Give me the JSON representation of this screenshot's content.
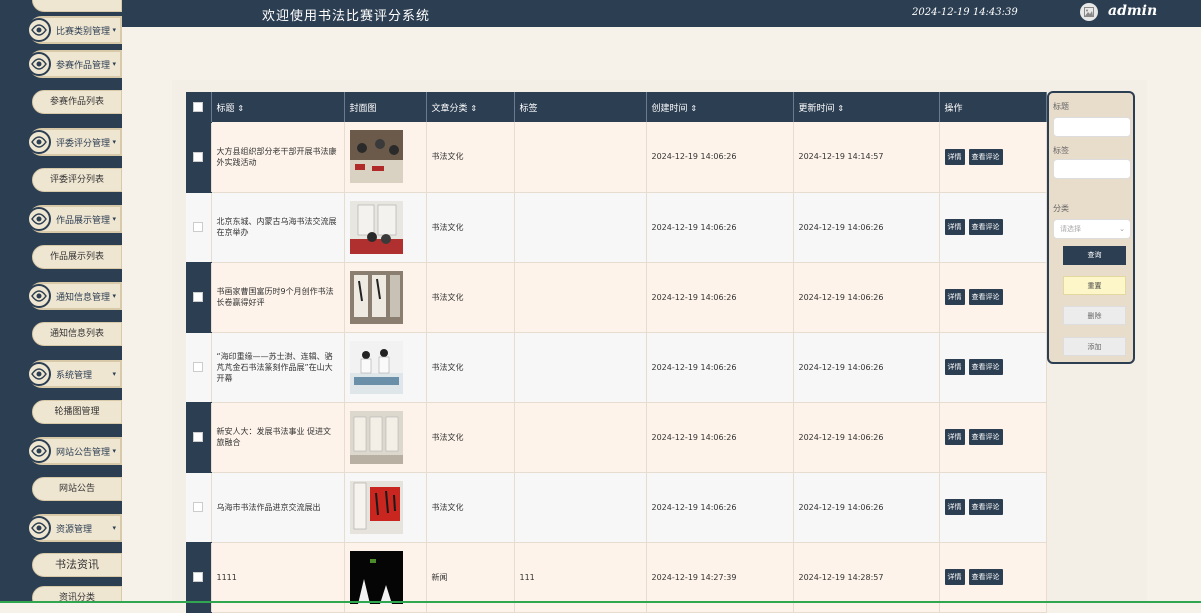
{
  "header": {
    "title": "欢迎使用书法比赛评分系统",
    "time": "2024-12-19 14:43:39",
    "user": "admin"
  },
  "sidebar": {
    "groups": [
      {
        "label": "比赛类别管理"
      },
      {
        "label": "参赛作品管理"
      },
      {
        "label": "评委评分管理"
      },
      {
        "label": "作品展示管理"
      },
      {
        "label": "通知信息管理"
      },
      {
        "label": "系统管理"
      },
      {
        "label": "网站公告管理"
      },
      {
        "label": "资源管理"
      }
    ],
    "items": [
      {
        "label": "参赛作品列表"
      },
      {
        "label": "评委评分列表"
      },
      {
        "label": "作品展示列表"
      },
      {
        "label": "通知信息列表"
      },
      {
        "label": "轮播图管理"
      },
      {
        "label": "网站公告"
      },
      {
        "label": "书法资讯"
      },
      {
        "label": "资讯分类"
      }
    ]
  },
  "table": {
    "headers": {
      "title": "标题",
      "cover": "封面图",
      "category": "文章分类",
      "tag": "标签",
      "created": "创建时间",
      "updated": "更新时间",
      "ops": "操作"
    },
    "sort_icon": "⇕",
    "rows": [
      {
        "title": "大方县组织部分老干部开展书法康外实践活动",
        "category": "书法文化",
        "tag": "",
        "created": "2024-12-19 14:06:26",
        "updated": "2024-12-19 14:14:57"
      },
      {
        "title": "北京东城、内蒙古乌海书法交流展在京举办",
        "category": "书法文化",
        "tag": "",
        "created": "2024-12-19 14:06:26",
        "updated": "2024-12-19 14:06:26"
      },
      {
        "title": "书画家曹国富历时9个月创作书法长卷赢得好评",
        "category": "书法文化",
        "tag": "",
        "created": "2024-12-19 14:06:26",
        "updated": "2024-12-19 14:06:26"
      },
      {
        "title": "“海印重缘——苏士澍、连辑、骆芃芃金石书法篆刻作品展”在山大开幕",
        "category": "书法文化",
        "tag": "",
        "created": "2024-12-19 14:06:26",
        "updated": "2024-12-19 14:06:26"
      },
      {
        "title": "新安人大：发展书法事业 促进文旅融合",
        "category": "书法文化",
        "tag": "",
        "created": "2024-12-19 14:06:26",
        "updated": "2024-12-19 14:06:26"
      },
      {
        "title": "乌海市书法作品进京交流展出",
        "category": "书法文化",
        "tag": "",
        "created": "2024-12-19 14:06:26",
        "updated": "2024-12-19 14:06:26"
      },
      {
        "title": "1111",
        "category": "新闻",
        "tag": "111",
        "created": "2024-12-19 14:27:39",
        "updated": "2024-12-19 14:28:57"
      }
    ],
    "detail_label": "详情",
    "comment_label": "查看评论"
  },
  "search": {
    "title_label": "标题",
    "tag_label": "标签",
    "category_label": "分类",
    "category_placeholder": "请选择",
    "query_label": "查询",
    "reset_label": "重置",
    "delete_label": "删除",
    "add_label": "添加"
  },
  "colors": {
    "navy": "#2c3e52",
    "cream": "#efe6d2",
    "yellow_btn": "#fdf6c8",
    "gray_btn": "#ececec"
  }
}
